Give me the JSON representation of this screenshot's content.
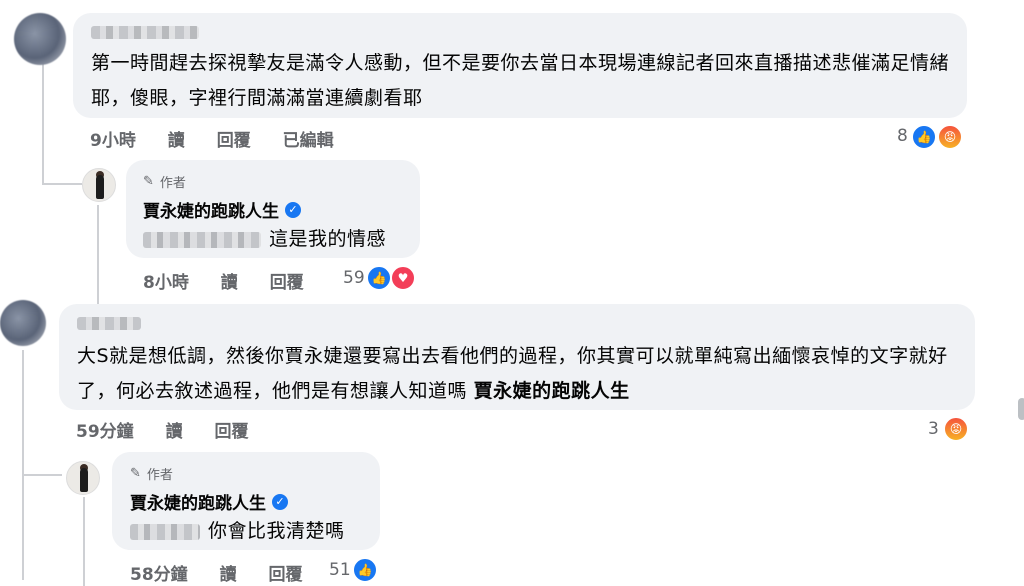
{
  "comment1": {
    "text": "第一時間趕去探視摯友是滿令人感動，但不是要你去當日本現場連線記者回來直播描述悲催滿足情緒耶，傻眼，字裡行間滿滿當連續劇看耶",
    "time": "9小時",
    "action_read": "讀",
    "action_reply": "回覆",
    "edited": "已編輯",
    "reaction_count": "8",
    "reactions": [
      "like-icon",
      "angry-icon"
    ]
  },
  "reply1": {
    "author_tag": "作者",
    "author_name": "賈永婕的跑跳人生",
    "text": "這是我的情感",
    "time": "8小時",
    "action_read": "讀",
    "action_reply": "回覆",
    "reaction_count": "59",
    "reactions": [
      "like-icon",
      "love-icon"
    ]
  },
  "comment2": {
    "text": "大S就是想低調，然後你賈永婕還要寫出去看他們的過程，你其實可以就單純寫出緬懷哀悼的文字就好了，何必去敘述過程，他們是有想讓人知道嗎",
    "mention": "賈永婕的跑跳人生",
    "time": "59分鐘",
    "action_read": "讀",
    "action_reply": "回覆",
    "reaction_count": "3",
    "reactions": [
      "angry-icon"
    ]
  },
  "reply2": {
    "author_tag": "作者",
    "author_name": "賈永婕的跑跳人生",
    "text": "你會比我清楚嗎",
    "time": "58分鐘",
    "action_read": "讀",
    "action_reply": "回覆",
    "reaction_count": "51",
    "reactions": [
      "like-icon"
    ]
  },
  "colors": {
    "bubble": "#f0f2f5",
    "like": "#1877f2",
    "love": "#f33e58",
    "meta": "#65676b"
  }
}
